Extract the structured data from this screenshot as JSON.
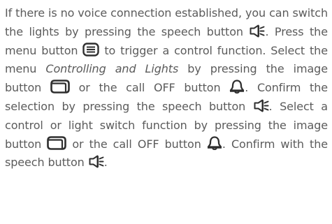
{
  "paragraph": {
    "t1": "If there is no voice connection established, you can switch the lights by pressing the speech button",
    "t2": ". Press the menu button",
    "t3": " to trigger a control function. Select the menu",
    "menu_name": "Controlling and Lights",
    "t4": " by pressing the image button",
    "t5": " or the call OFF button",
    "t6": ". Confirm the selection by pressing the speech button",
    "t7": ". Select a control or light switch function by pressing the image button",
    "t8": " or the call OFF button",
    "t9": ". Confirm with the speech but­ton",
    "t10": "."
  },
  "icons": [
    "speech-icon",
    "menu-icon",
    "image-icon",
    "bell-icon"
  ],
  "colors": {
    "text": "#5b5b5b",
    "icon": "#2f2f2f"
  }
}
